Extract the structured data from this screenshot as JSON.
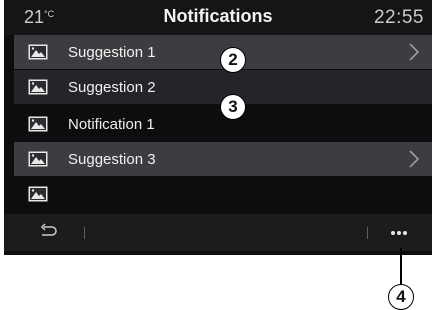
{
  "status_bar": {
    "temperature": "21",
    "temperature_unit": "°C",
    "title": "Notifications",
    "time": "22:55"
  },
  "list": [
    {
      "label": "Suggestion 1",
      "has_chevron": true
    },
    {
      "label": "Suggestion 2",
      "has_chevron": false
    },
    {
      "label": "Notification 1",
      "has_chevron": false
    },
    {
      "label": "Suggestion 3",
      "has_chevron": true
    },
    {
      "label": "",
      "has_chevron": false
    }
  ],
  "icons": {
    "row_icon": "image-icon",
    "chevron": "chevron-right-icon",
    "back": "back-arrow-icon",
    "more": "more-options-icon"
  },
  "callouts": {
    "c2": "2",
    "c3": "3",
    "c4": "4"
  },
  "colors": {
    "screen_bg": "#0c0d0e",
    "row_light": "#3b3d40",
    "row_dark": "#232528",
    "text": "#f0f0f0"
  }
}
